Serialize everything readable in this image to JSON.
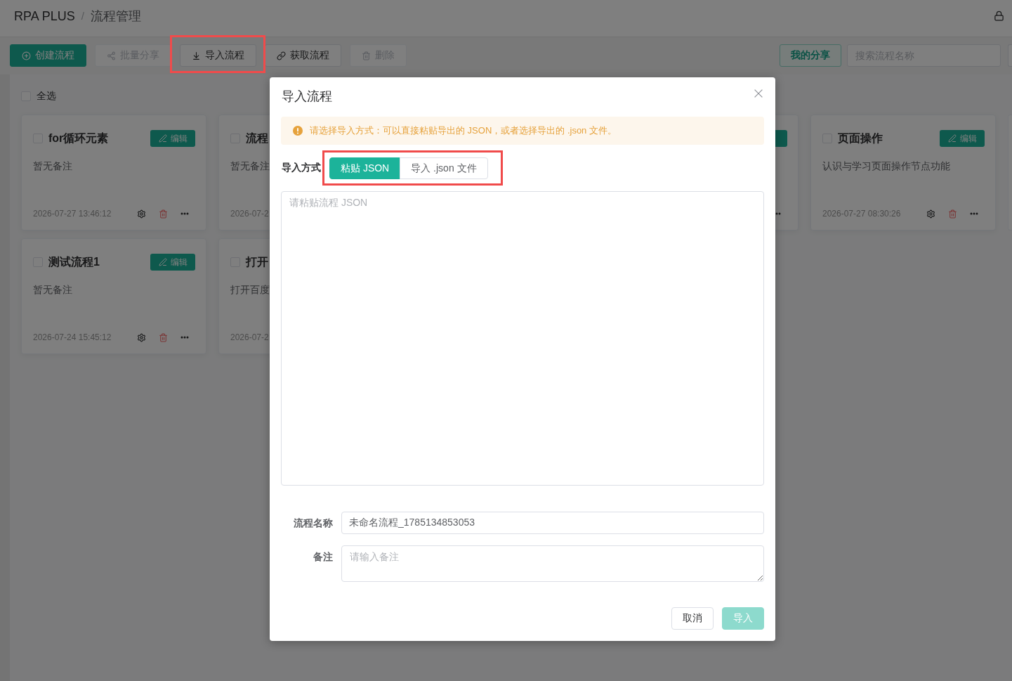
{
  "breadcrumb": {
    "items": [
      {
        "label": "RPA PLUS"
      },
      {
        "label": "流程管理"
      }
    ],
    "separator": "/"
  },
  "toolbar": {
    "actions": [
      {
        "kind": "create",
        "label": "创建流程",
        "disabled": false,
        "highlighted": false
      },
      {
        "kind": "share",
        "label": "批量分享",
        "disabled": true,
        "highlighted": false
      },
      {
        "kind": "import",
        "label": "导入流程",
        "disabled": false,
        "highlighted": true
      },
      {
        "kind": "fetch",
        "label": "获取流程",
        "disabled": false,
        "highlighted": false
      },
      {
        "kind": "delete",
        "label": "删除",
        "disabled": true,
        "highlighted": false
      }
    ],
    "my_share": {
      "label": "我的分享"
    },
    "search": {
      "placeholder": "搜索流程名称"
    }
  },
  "select_all": {
    "label": "全选",
    "checked": false
  },
  "card_rows": [
    {
      "cards": [
        {
          "kind": "card",
          "title": "for循环元素",
          "note": "暂无备注",
          "date": "2026-07-27 13:46:12",
          "checked": false,
          "edit_label": "编辑"
        },
        {
          "kind": "cut",
          "title": "流程",
          "note": "暂无备注",
          "date": "2026-07-2",
          "checked": false
        },
        {
          "kind": "covered"
        },
        {
          "kind": "peek"
        },
        {
          "kind": "card",
          "title": "页面操作",
          "note": "认识与学习页面操作节点功能",
          "date": "2026-07-27 08:30:26",
          "checked": false,
          "edit_label": "编辑"
        },
        {
          "kind": "sliver"
        }
      ]
    },
    {
      "cards": [
        {
          "kind": "card",
          "title": "测试流程1",
          "note": "暂无备注",
          "date": "2026-07-24 15:45:12",
          "checked": false,
          "edit_label": "编辑"
        },
        {
          "kind": "cut",
          "title": "打开",
          "note": "打开百度",
          "date": "2026-07-2",
          "checked": false
        }
      ]
    }
  ],
  "dialog": {
    "title": "导入流程",
    "alert": "请选择导入方式：可以直接粘贴导出的 JSON，或者选择导出的 .json 文件。",
    "import_mode": {
      "label": "导入方式",
      "highlighted": true,
      "options": [
        {
          "label": "粘贴 JSON",
          "selected": true
        },
        {
          "label": "导入 .json 文件",
          "selected": false
        }
      ]
    },
    "json_input": {
      "placeholder": "请粘贴流程 JSON"
    },
    "fields": [
      {
        "kind": "input",
        "label": "流程名称",
        "value": "未命名流程_1785134853053"
      },
      {
        "kind": "textarea",
        "label": "备注",
        "placeholder": "请输入备注"
      }
    ],
    "buttons": [
      {
        "kind": "default",
        "label": "取消",
        "disabled": false
      },
      {
        "kind": "primary",
        "label": "导入",
        "disabled": true
      }
    ]
  }
}
